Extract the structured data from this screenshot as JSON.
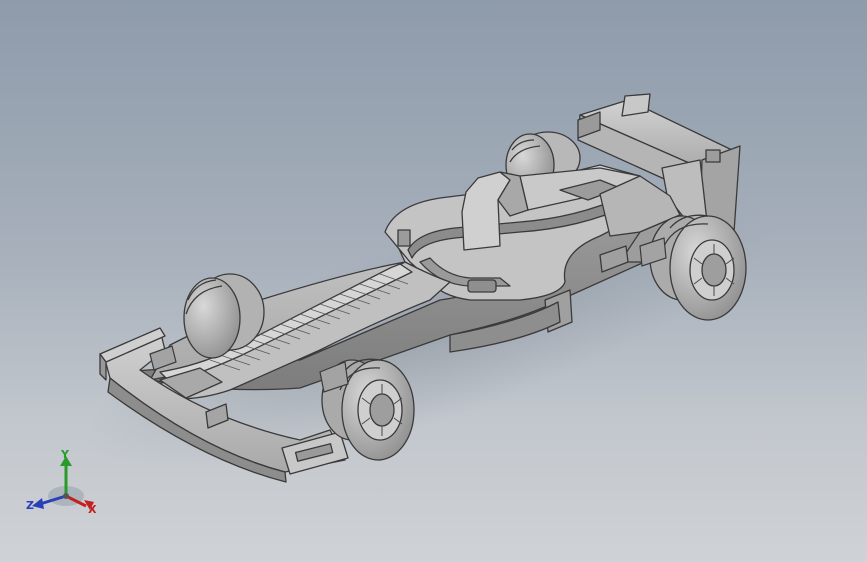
{
  "viewport": {
    "model_name": "",
    "background_top": "#8e9bab",
    "background_bottom": "#cfd2d6"
  },
  "triad": {
    "x_label": "X",
    "y_label": "Y",
    "z_label": "Z",
    "x_color": "#c42020",
    "y_color": "#2a9a2a",
    "z_color": "#2a3fb8"
  }
}
